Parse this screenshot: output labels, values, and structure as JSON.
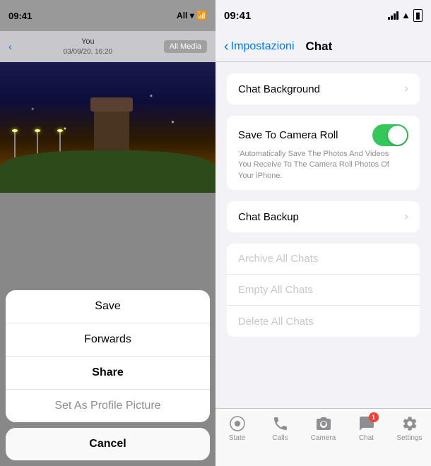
{
  "left": {
    "status_bar": {
      "time": "09:41"
    },
    "header": {
      "back_label": "‹",
      "you_label": "You",
      "date_label": "03/09/20, 16:20",
      "all_media_label": "All Media"
    },
    "action_sheet": {
      "items": [
        {
          "label": "Save",
          "style": "normal"
        },
        {
          "label": "Forwards",
          "style": "normal"
        },
        {
          "label": "Share",
          "style": "bold"
        },
        {
          "label": "Set As Profile Picture",
          "style": "gray"
        }
      ],
      "cancel_label": "Cancel"
    }
  },
  "right": {
    "status_bar": {
      "time": "09:41"
    },
    "nav": {
      "back_label": "Impostazioni",
      "title": "Chat"
    },
    "sections": [
      {
        "rows": [
          {
            "label": "Chat Background",
            "has_chevron": true,
            "toggle": false
          }
        ]
      },
      {
        "rows": [
          {
            "label": "Save To Camera Roll",
            "has_chevron": false,
            "toggle": true,
            "toggle_on": true,
            "sublabel": "'Automatically Save The Photos And Videos You Receive To The Camera Roll Photos Of Your iPhone."
          }
        ]
      },
      {
        "rows": [
          {
            "label": "Chat Backup",
            "has_chevron": true,
            "toggle": false
          }
        ]
      },
      {
        "rows": [
          {
            "label": "Archive All Chats",
            "has_chevron": false,
            "toggle": false,
            "disabled": true
          },
          {
            "label": "Empty All Chats",
            "has_chevron": false,
            "toggle": false,
            "disabled": true
          },
          {
            "label": "Delete All Chats",
            "has_chevron": false,
            "toggle": false,
            "disabled": true
          }
        ]
      }
    ],
    "tab_bar": {
      "items": [
        {
          "label": "State",
          "icon": "🔄",
          "active": false,
          "badge": null
        },
        {
          "label": "Calls",
          "icon": "📞",
          "active": false,
          "badge": null
        },
        {
          "label": "Camera",
          "icon": "📷",
          "active": false,
          "badge": null
        },
        {
          "label": "Chat",
          "icon": "💬",
          "active": false,
          "badge": "1"
        },
        {
          "label": "Settings",
          "icon": "⚙️",
          "active": false,
          "badge": null
        }
      ]
    }
  }
}
